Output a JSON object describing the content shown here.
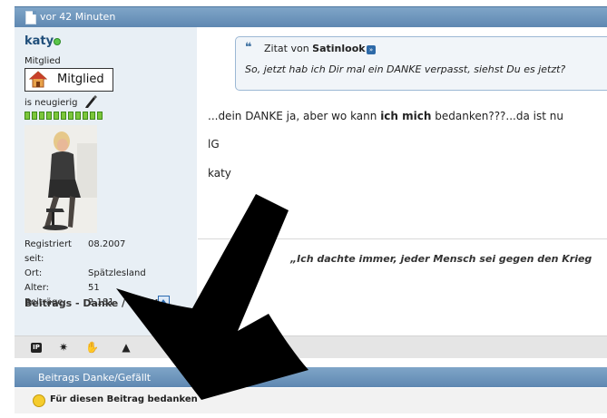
{
  "post": {
    "time_label": "vor 42 Minuten",
    "message_lines": [
      "...dein DANKE ja, aber wo kann ",
      "ich mich",
      " bedanken???...da ist nu"
    ],
    "greeting": "lG",
    "signoff": "katy",
    "signature": "„Ich dachte immer, jeder Mensch sei gegen den Krieg"
  },
  "user": {
    "name": "katy",
    "rank_label": "Mitglied",
    "rank_badge": "Mitglied",
    "mood": "is neugierig",
    "reputation_pips": 11,
    "stats": [
      {
        "key": "Registriert seit:",
        "value": "08.2007"
      },
      {
        "key": "Ort:",
        "value": "Spätzlesland"
      },
      {
        "key": "Alter:",
        "value": "51"
      },
      {
        "key": "Beiträge:",
        "value": "2.181"
      }
    ],
    "thanks_label": "Beitrags - Danke / Gefällt"
  },
  "quote": {
    "prefix": "Zitat von",
    "author": "Satinlook",
    "text": "So, jetzt hab ich Dir mal ein DANKE verpasst, siehst Du es jetzt?"
  },
  "toolbar": {
    "icons": [
      "ip-icon",
      "star-icon",
      "handshake-icon",
      "warning-icon"
    ],
    "ip_label": "IP"
  },
  "thanks_section": {
    "title": "Beitrags Danke/Gefällt",
    "link": "Für diesen Beitrag bedanken"
  },
  "colors": {
    "header": "#6d96bd",
    "username": "#1f4e7a",
    "sidebar": "#e8eff5",
    "rep": "#7bc63a"
  }
}
